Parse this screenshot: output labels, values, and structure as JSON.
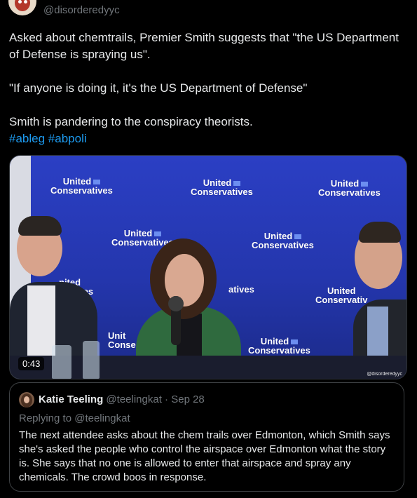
{
  "tweet": {
    "handle": "@disorderedyyc",
    "paragraph1": "Asked about chemtrails, Premier Smith suggests that \"the US Department of Defense is spraying us\".",
    "paragraph2": "\"If anyone is doing it, it's the US Department of Defense\"",
    "paragraph3": "Smith is pandering to the conspiracy theorists.",
    "hashtags": [
      "#ableg",
      "#abpoli"
    ]
  },
  "media": {
    "duration": "0:43",
    "watermark": "@disorderedyyc",
    "logo_line1": "United",
    "logo_line2": "Conservatives",
    "partial_logos": [
      "nited",
      "rvatives",
      "atives",
      "Unit",
      "Conse",
      "United",
      "Conservativ"
    ]
  },
  "quote": {
    "name": "Katie Teeling",
    "handle": "@teelingkat",
    "separator": "·",
    "date": "Sep 28",
    "replying_to": "Replying to @teelingkat",
    "text": "The next attendee asks about the chem trails over Edmonton, which Smith says she's asked the people who control the airspace over Edmonton what the story is. She says that no one is allowed to enter that airspace and spray any chemicals. The crowd boos in response."
  },
  "colors": {
    "background": "#000000",
    "text": "#e7e9ea",
    "muted": "#71767b",
    "link": "#1d9bf0",
    "border": "#3e4144",
    "backdrop_blue": "#2637a6"
  }
}
